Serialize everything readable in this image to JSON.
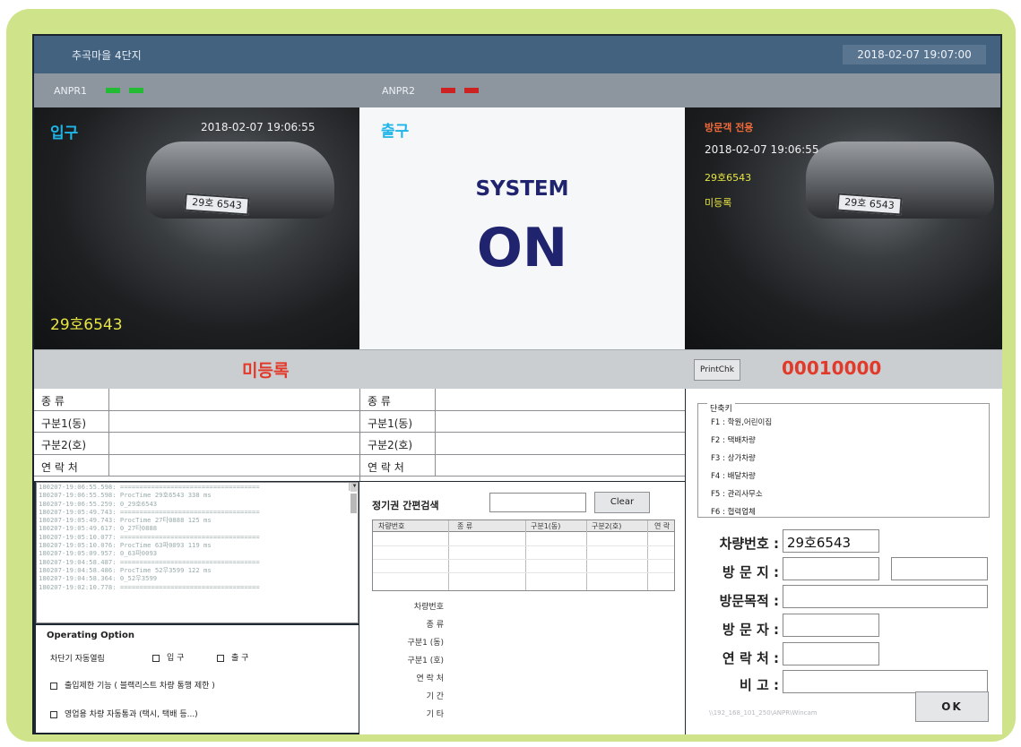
{
  "window": {
    "title": "추곡마을 4단지",
    "datetime": "2018-02-07 19:07:00"
  },
  "status": {
    "anpr1": {
      "label": "ANPR1",
      "color": "#22bb33"
    },
    "anpr2": {
      "label": "ANPR2",
      "color": "#cc2222"
    }
  },
  "entrance": {
    "heading": "입구",
    "timestamp": "2018-02-07 19:06:55",
    "plate": "29호6543",
    "plate_image_text": "29호 6543",
    "status": "미등록"
  },
  "exit": {
    "heading": "출구",
    "system_label": "SYSTEM",
    "system_state": "ON"
  },
  "visitor_cam": {
    "heading": "방문객 전용",
    "timestamp": "2018-02-07 19:06:55",
    "plate": "29호6543",
    "status": "미등록",
    "plate_image_text": "29호 6543"
  },
  "print_button": "PrintChk",
  "counter": "00010000",
  "info_labels": [
    "종 류",
    "구분1(동)",
    "구분2(호)",
    "연 락 처"
  ],
  "log_lines": [
    "180207-19:06:55.598: ====================================",
    "180207-19:06:55.598: ProcTime  29호6543  338 ms",
    "180207-19:06:55.259: 0_29호6543",
    "180207-19:05:49.743: ====================================",
    "180207-19:05:49.743: ProcTime  27타0888  125 ms",
    "180207-19:05:49.617: 0_27타0888",
    "180207-19:05:10.077: ====================================",
    "180207-19:05:10.076: ProcTime  63파0093  119 ms",
    "180207-19:05:09.957: 0_63파0093",
    "180207-19:04:58.487: ====================================",
    "180207-19:04:58.486: ProcTime  52우3599  122 ms",
    "180207-19:04:58.364: 0_52우3599",
    "180207-19:02:10.778: ===================================="
  ],
  "operating": {
    "title": "Operating Option",
    "gate_auto": "차단기 자동열림",
    "entrance": "입 구",
    "exit": "출 구",
    "restriction": "출입제한 기능 ( 블랙리스트 차량 통행 제한 )",
    "business": "영업용 차량 자동통과 (택시, 택배 등...)"
  },
  "quick_search": {
    "label": "정기권 간편검색",
    "query": "",
    "clear_label": "Clear",
    "columns": [
      "차량번호",
      "종 류",
      "구분1(동)",
      "구분2(호)",
      "연 락"
    ]
  },
  "detail_labels": [
    "차량번호",
    "종 류",
    "구분1 (동)",
    "구분1 (호)",
    "연 락 처",
    "기 간",
    "기 타"
  ],
  "shortcuts": {
    "title": "단축키",
    "items": [
      "F1 : 학원,어린이집",
      "F2 : 택배차량",
      "F3 : 상가차량",
      "F4 : 배달차량",
      "F5 : 관리사무소",
      "F6 : 협력업체"
    ]
  },
  "visitor_form": {
    "plate_label": "차량번호 :",
    "plate_value": "29호6543",
    "destination_label": "방 문 지 :",
    "purpose_label": "방문목적 :",
    "visitor_label": "방 문 자 :",
    "contact_label": "연 락 처 :",
    "note_label": "비 고 :",
    "footer_path": "\\\\192_168_101_250\\ANPR\\Wincam",
    "ok_label": "OK"
  }
}
